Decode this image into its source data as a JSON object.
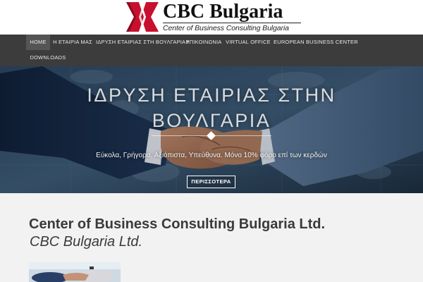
{
  "logo": {
    "title": "CBC Bulgaria",
    "subtitle": "Center of Business Consulting Bulgaria",
    "mark_colors": {
      "red": "#c8102e",
      "dark": "#1a1a1a"
    }
  },
  "nav": {
    "items": [
      {
        "label": "HOME",
        "active": true
      },
      {
        "label": "Η ΕΤΑΙΡΙΑ ΜΑΣ"
      },
      {
        "label": "ΙΔΡΥΣΗ ΕΤΑΙΡΙΑΣ ΣΤΗ ΒΟΥΛΓΑΡΙΑ",
        "has_dropdown": true,
        "dropdown_icon": "chevron-down-icon"
      },
      {
        "label": "ΕΠΙΚΟΙΝΩΝΙΑ"
      },
      {
        "label": "VIRTUAL OFFICE"
      },
      {
        "label": "EUROPEAN BUSINESS CENTER"
      },
      {
        "label": "DOWNLOADS"
      }
    ]
  },
  "hero": {
    "title": "ΙΔΡΥΣΗ ΕΤΑΙΡΙΑΣ ΣΤΗΝ ΒΟΥΛΓΑΡΙΑ",
    "subtitle": "Εύκολα, Γρήγορα, Αξιόπιστα, Υπεύθυνα. Μόνο 10% φόρο επί των κερδών",
    "button_label": "ΠΕΡΙΣΣΟΤΕΡΑ"
  },
  "main": {
    "company_name": "Center of Business Consulting Bulgaria Ltd.",
    "company_short": "CBC Bulgaria Ltd."
  },
  "colors": {
    "nav_bg": "#3c3c3c",
    "nav_active_bg": "#555555",
    "content_bg": "#f2f2f2",
    "text_dark": "#3a3a3a"
  }
}
